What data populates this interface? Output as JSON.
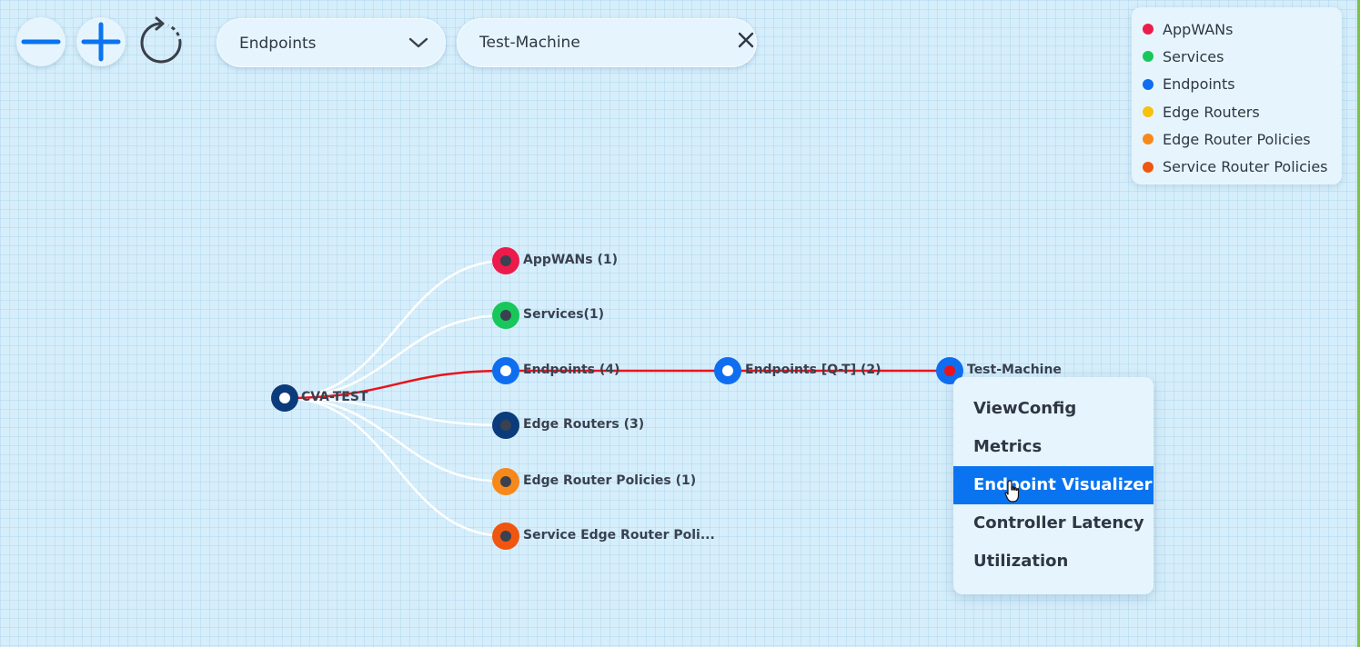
{
  "toolbar": {
    "zoom_out_icon": "minus-icon",
    "zoom_in_icon": "plus-icon",
    "reset_icon": "refresh-icon",
    "type_select": {
      "value": "Endpoints",
      "icon": "chevron-down-icon"
    },
    "search": {
      "value": "Test-Machine",
      "clear_icon": "close-icon"
    }
  },
  "legend": {
    "items": [
      {
        "label": "AppWANs",
        "color": "#ec1b4b"
      },
      {
        "label": "Services",
        "color": "#18c75a"
      },
      {
        "label": "Endpoints",
        "color": "#0f6ef0"
      },
      {
        "label": "Edge Routers",
        "color": "#f6c20c"
      },
      {
        "label": "Edge Router Policies",
        "color": "#f7891b"
      },
      {
        "label": "Service Router Policies",
        "color": "#f0560f"
      }
    ]
  },
  "graph": {
    "root": {
      "label": "CVA-TEST",
      "color": "#0b3b7a"
    },
    "children": [
      {
        "label": "AppWANs (1)",
        "color": "#ec1b4b"
      },
      {
        "label": "Services(1)",
        "color": "#18c75a"
      },
      {
        "label": "Endpoints (4)",
        "color": "#0f6ef0"
      },
      {
        "label": "Edge Routers (3)",
        "color": "#0b3b7a"
      },
      {
        "label": "Edge Router Policies (1)",
        "color": "#f7891b"
      },
      {
        "label": "Service Edge Router Poli...",
        "color": "#f0560f"
      }
    ],
    "path_nodes": [
      {
        "label": "Endpoints [Q-T] (2)",
        "color": "#0f6ef0"
      },
      {
        "label": "Test-Machine",
        "color": "#0f6ef0",
        "center_color": "#e8141c"
      }
    ],
    "highlight_color": "#e8141c"
  },
  "context_menu": {
    "items": [
      {
        "label": "ViewConfig",
        "active": false
      },
      {
        "label": "Metrics",
        "active": false
      },
      {
        "label": "Endpoint Visualizer",
        "active": true
      },
      {
        "label": "Controller Latency",
        "active": false
      },
      {
        "label": "Utilization",
        "active": false
      }
    ]
  }
}
